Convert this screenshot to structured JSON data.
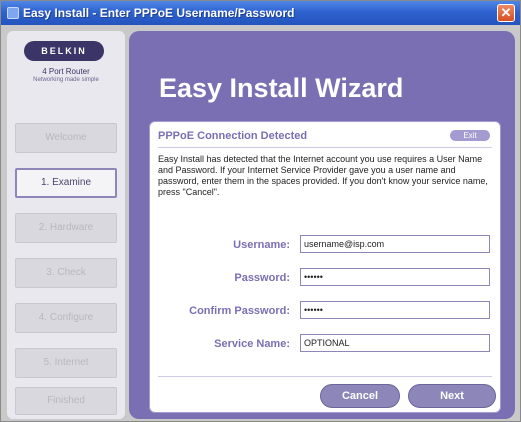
{
  "window": {
    "title": "Easy Install - Enter PPPoE Username/Password",
    "close_label": "✕"
  },
  "sidebar": {
    "logo": "BELKIN",
    "product": "4 Port Router",
    "tagline": "Networking made simple",
    "steps": [
      {
        "label": "Welcome",
        "active": false
      },
      {
        "label": "1. Examine",
        "active": true
      },
      {
        "label": "2. Hardware",
        "active": false
      },
      {
        "label": "3. Check",
        "active": false
      },
      {
        "label": "4. Configure",
        "active": false
      },
      {
        "label": "5. Internet",
        "active": false
      },
      {
        "label": "Finished",
        "active": false
      }
    ]
  },
  "main": {
    "wizard_title": "Easy Install Wizard",
    "section_title": "PPPoE Connection Detected",
    "exit_label": "Exit",
    "description": "Easy Install has detected that the Internet account you use requires a User Name and Password. If your Internet Service Provider gave you a user name and password, enter them in the spaces provided. If you don't know your service name, press \"Cancel\".",
    "fields": {
      "username": {
        "label": "Username:",
        "value": "username@isp.com"
      },
      "password": {
        "label": "Password:",
        "value": "••••••"
      },
      "confirm_password": {
        "label": "Confirm Password:",
        "value": "••••••"
      },
      "service_name": {
        "label": "Service Name:",
        "value": "OPTIONAL"
      }
    },
    "buttons": {
      "cancel": "Cancel",
      "next": "Next"
    }
  },
  "colors": {
    "accent_purple": "#7b6fb3",
    "title_bar_blue": "#2f62cf",
    "button_purple": "#8d86b8"
  }
}
